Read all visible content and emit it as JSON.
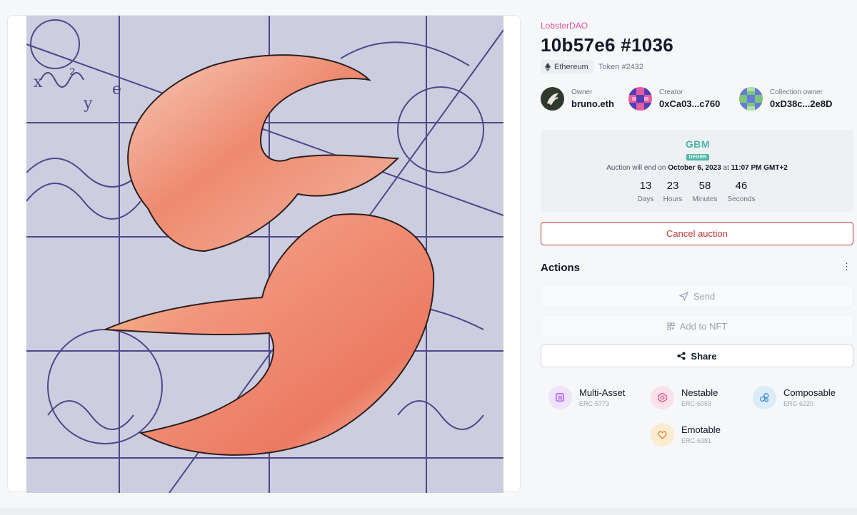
{
  "collection": "LobsterDAO",
  "title": "10b57e6 #1036",
  "chain": {
    "name": "Ethereum",
    "icon": "ethereum-icon"
  },
  "token": "Token #2432",
  "people": [
    {
      "label": "Owner",
      "value": "bruno.eth"
    },
    {
      "label": "Creator",
      "value": "0xCa03...c760"
    },
    {
      "label": "Collection owner",
      "value": "0xD38c...2e8D"
    }
  ],
  "auction": {
    "logo_word": "GBM",
    "logo_sub": "DEGEN",
    "prefix": "Auction will end on",
    "date": "October 6, 2023",
    "at": "at",
    "time": "11:07 PM GMT+2",
    "countdown": [
      {
        "value": "13",
        "unit": "Days"
      },
      {
        "value": "23",
        "unit": "Hours"
      },
      {
        "value": "58",
        "unit": "Minutes"
      },
      {
        "value": "46",
        "unit": "Seconds"
      }
    ]
  },
  "cancel_label": "Cancel auction",
  "actions": {
    "title": "Actions",
    "more_glyph": "⋮",
    "send": "Send",
    "add_to_nft": "Add to NFT",
    "share": "Share"
  },
  "features": [
    {
      "title": "Multi-Asset",
      "sub": "ERC-5773",
      "icon": "multi-asset-icon",
      "color": "#a855f7",
      "bg": "#ede4fb"
    },
    {
      "title": "Nestable",
      "sub": "ERC-6059",
      "icon": "nestable-icon",
      "color": "#e25590",
      "bg": "#fbe1ea"
    },
    {
      "title": "Composable",
      "sub": "ERC-6220",
      "icon": "composable-icon",
      "color": "#3b8fd6",
      "bg": "#dcebf8"
    },
    {
      "title": "Emotable",
      "sub": "ERC-6381",
      "icon": "emotable-icon",
      "color": "#d98a2b",
      "bg": "#fbecd0"
    }
  ],
  "colors": {
    "collection": "#e0529b",
    "danger": "#c53a3a",
    "gbm": "#4db6a7"
  }
}
